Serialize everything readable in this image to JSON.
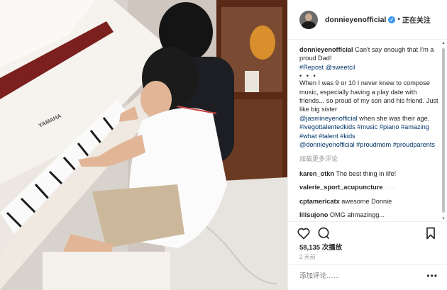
{
  "post": {
    "media": {
      "description_icon": "video-still-icon",
      "piano_brand": "YAMAHA"
    },
    "header": {
      "username": "donnieyenofficial",
      "separator": "•",
      "follow_state": "正在关注"
    },
    "caption": {
      "username": "donnieyenofficial",
      "text": "Can't say enough that I'm a proud Dad!",
      "repost": "#Repost",
      "repost_user": "@sweetcil",
      "dots": "• • •",
      "body": "When I was 9 or 10 I never knew to compose music, especially having a play date with friends... so proud of my son and his friend. Just like big sister",
      "mention1": "@jasmineyenofficial",
      "body2": "when she was their age.",
      "tags1": "#ivegottalentedkids #music #piano #amazing #what #talent #kids",
      "mention2": "@donnieyenofficial",
      "tags2": "#proudmom #proudparents"
    },
    "load_more": "加载更多评论",
    "comments": [
      {
        "user": "karen_otkn",
        "text": "The best thing in life!"
      },
      {
        "user": "valerie_sport_acupuncture",
        "text": "◌◌◌"
      },
      {
        "user": "cptamericatx",
        "text": "awesome Donnie"
      },
      {
        "user": "lilisujono",
        "text": "OMG ahmazingg..."
      }
    ],
    "likes": "58,135 次播放",
    "time": "2 天前",
    "add_comment_placeholder": "添加评论……",
    "more_label": "•••"
  },
  "colors": {
    "link": "#003569",
    "verified": "#3897f0",
    "muted": "#999999"
  }
}
